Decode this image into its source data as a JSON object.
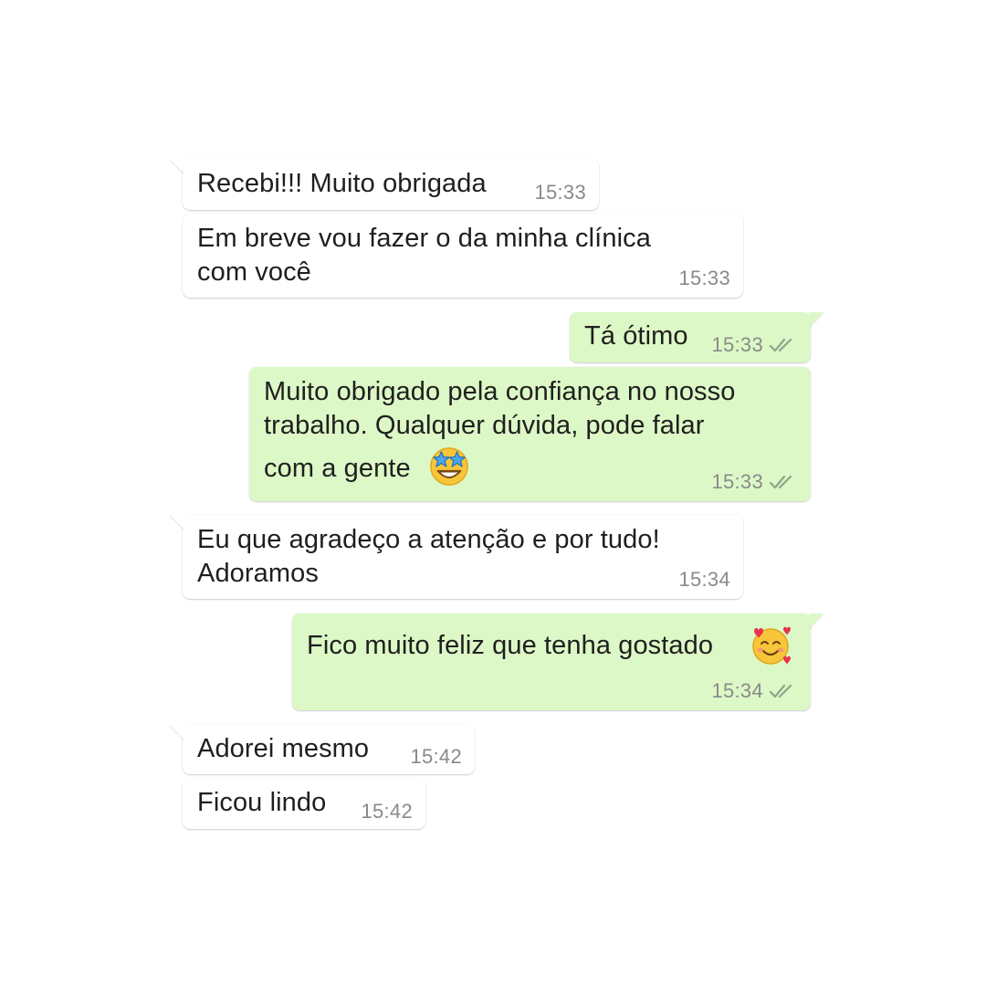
{
  "colors": {
    "incoming_bubble": "#ffffff",
    "outgoing_bubble": "#dcf8c6",
    "timestamp": "#8a8a8a",
    "ticks": "#8fa38a"
  },
  "messages": [
    {
      "direction": "incoming",
      "line1": "Recebi!!! Muito obrigada",
      "time": "15:33"
    },
    {
      "direction": "incoming",
      "line1": "Em breve vou fazer o da minha clínica",
      "line2": "com você",
      "time": "15:33"
    },
    {
      "direction": "outgoing",
      "line1": "Tá ótimo",
      "time": "15:33",
      "status": "double-check-icon"
    },
    {
      "direction": "outgoing",
      "line1": "Muito obrigado pela confiança no nosso",
      "line2": "trabalho. Qualquer dúvida, pode falar",
      "line3": "com a gente",
      "emoji": "star-struck-emoji-icon",
      "time": "15:33",
      "status": "double-check-icon"
    },
    {
      "direction": "incoming",
      "line1": "Eu que agradeço a atenção e por tudo!",
      "line2": "Adoramos",
      "time": "15:34"
    },
    {
      "direction": "outgoing",
      "line1": "Fico muito feliz que tenha gostado",
      "emoji": "smiling-face-with-hearts-emoji-icon",
      "time": "15:34",
      "status": "double-check-icon"
    },
    {
      "direction": "incoming",
      "line1": "Adorei mesmo",
      "time": "15:42"
    },
    {
      "direction": "incoming",
      "line1": "Ficou lindo",
      "time": "15:42"
    }
  ]
}
